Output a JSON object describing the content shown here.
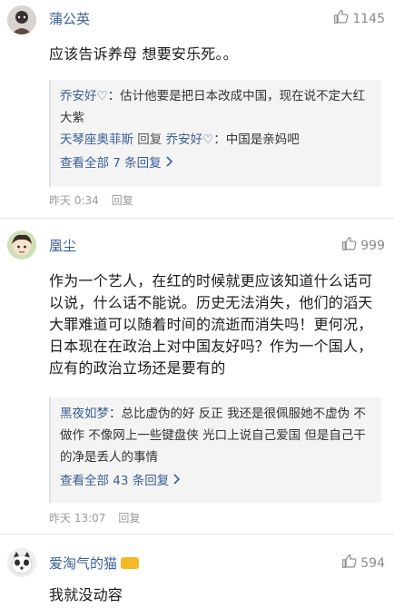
{
  "comments": [
    {
      "username": "蒲公英",
      "likes": "1145",
      "text": "应该告诉养母  想要安乐死。。",
      "replies": [
        {
          "name": "乔安好♡",
          "sep": "：",
          "text": "估计他要是把日本改成中国，现在说不定大红大紫"
        },
        {
          "name": "天琴座奥菲斯",
          "mid": " 回复 ",
          "target": "乔安好♡",
          "sep": "：",
          "text": "中国是亲妈吧"
        }
      ],
      "view_all": "查看全部 7 条回复",
      "time": "昨天 0:34",
      "reply_label": "回复"
    },
    {
      "username": "凰尘",
      "likes": "999",
      "text": "作为一个艺人，在红的时候就更应该知道什么话可以说，什么话不能说。历史无法消失，他们的滔天大罪难道可以随着时间的流逝而消失吗！更何况，日本现在在政治上对中国友好吗？作为一个国人，应有的政治立场还是要有的",
      "replies": [
        {
          "name": "黑夜如梦",
          "sep": "：",
          "text": "总比虚伪的好  反正  我还是很佩服她不虚伪  不做作  不像网上一些键盘侠 光口上说自己爱国 但是自己干的净是丢人的事情"
        }
      ],
      "view_all": "查看全部 43 条回复",
      "time": "昨天 13:07",
      "reply_label": "回复"
    },
    {
      "username": "爱淘气的猫",
      "likes": "594",
      "text": "我就没动容"
    }
  ],
  "icons": {
    "like": "thumbs-up-icon",
    "chevron": "chevron-right-icon",
    "badge": "vip-badge-icon"
  },
  "colors": {
    "link": "#3a5f95",
    "meta": "#9a9a9a",
    "reply_bg": "#f4f4f4",
    "badge": "#f5b826"
  }
}
